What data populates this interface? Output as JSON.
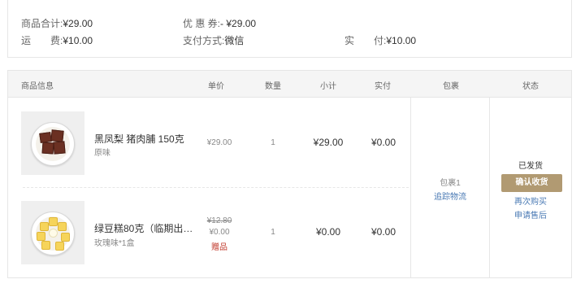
{
  "summary": {
    "goods_total_label": "商品合计:",
    "goods_total_value": "¥29.00",
    "coupon_label": "优 惠 券:",
    "coupon_value": "- ¥29.00",
    "shipping_label": "运　　费:",
    "shipping_value": "¥10.00",
    "payment_method_label": "支付方式:",
    "payment_method_value": "微信",
    "paid_label": "实　　付:",
    "paid_value": "¥10.00"
  },
  "table": {
    "headers": [
      "商品信息",
      "单价",
      "数量",
      "小计",
      "实付",
      "包裹",
      "状态"
    ]
  },
  "products": [
    {
      "name": "黑凤梨 猪肉脯 150克",
      "spec": "原味",
      "unit_price": "¥29.00",
      "qty": "1",
      "subtotal": "¥29.00",
      "paid": "¥0.00",
      "image_icon": "pork-jerky-plate-icon"
    },
    {
      "name": "绿豆糕80克（临期出…",
      "spec": "玫瑰味*1盒",
      "original_price": "¥12.80",
      "unit_price": "¥0.00",
      "gift_label": "赠品",
      "qty": "1",
      "subtotal": "¥0.00",
      "paid": "¥0.00",
      "image_icon": "mung-bean-cake-plate-icon"
    }
  ],
  "package": {
    "label": "包裹1",
    "track_link": "追踪物流"
  },
  "status": {
    "text": "已发货",
    "confirm_button": "确认收货",
    "rebuy_link": "再次购买",
    "after_sale_link": "申请售后"
  },
  "colors": {
    "accent": "#b19a72",
    "link": "#4a7ab4",
    "gift": "#c0392b"
  }
}
